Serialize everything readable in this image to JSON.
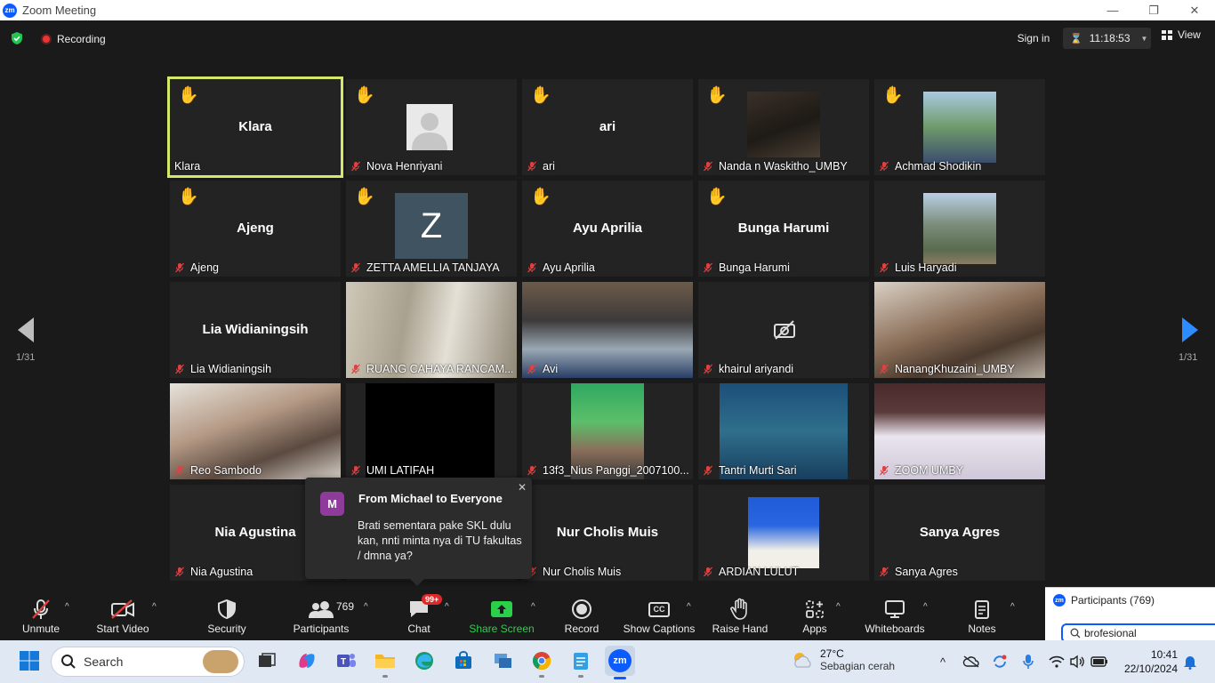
{
  "window": {
    "title": "Zoom Meeting",
    "logo": "zm"
  },
  "topbar": {
    "recording": "Recording",
    "sign_in": "Sign in",
    "timer": "11:18:53",
    "view": "View"
  },
  "gallery": {
    "page_left": "1/31",
    "page_right": "1/31",
    "tiles": [
      {
        "name": "Klara",
        "display": "Klara",
        "hand": true
      },
      {
        "name": "Nova Henriyani",
        "display": "",
        "hand": true
      },
      {
        "name": "ari",
        "display": "ari",
        "hand": true
      },
      {
        "name": "Nanda n Waskitho_UMBY",
        "display": "",
        "hand": true
      },
      {
        "name": "Achmad Shodikin",
        "display": "",
        "hand": true
      },
      {
        "name": "Ajeng",
        "display": "Ajeng",
        "hand": true
      },
      {
        "name": "ZETTA AMELLIA TANJAYA",
        "display": "",
        "hand": true,
        "avatar_letter": "Z"
      },
      {
        "name": "Ayu Aprilia",
        "display": "Ayu Aprilia",
        "hand": true
      },
      {
        "name": "Bunga Harumi",
        "display": "Bunga Harumi",
        "hand": true
      },
      {
        "name": "Luis Haryadi",
        "display": "",
        "hand": false
      },
      {
        "name": "Lia Widianingsih",
        "display": "Lia Widianingsih",
        "hand": false
      },
      {
        "name": "RUANG CAHAYA RANCAM...",
        "display": "",
        "hand": false
      },
      {
        "name": "Avi",
        "display": "",
        "hand": false
      },
      {
        "name": "khairul ariyandi",
        "display": "",
        "hand": false
      },
      {
        "name": "NanangKhuzaini_UMBY",
        "display": "",
        "hand": false
      },
      {
        "name": "Reo Sambodo",
        "display": "",
        "hand": false
      },
      {
        "name": "UMI LATIFAH",
        "display": "",
        "hand": false
      },
      {
        "name": "13f3_Nius Panggi_2007100...",
        "display": "",
        "hand": false
      },
      {
        "name": "Tantri Murti Sari",
        "display": "",
        "hand": false
      },
      {
        "name": "ZOOM UMBY",
        "display": "",
        "hand": false
      },
      {
        "name": "Nia Agustina",
        "display": "Nia Agustina",
        "hand": false
      },
      {
        "name": "",
        "display": "",
        "hand": false
      },
      {
        "name": "Nur Cholis Muis",
        "display": "Nur Cholis Muis",
        "hand": false
      },
      {
        "name": "ARDIAN LULUT",
        "display": "",
        "hand": false
      },
      {
        "name": "Sanya Agres",
        "display": "Sanya Agres",
        "hand": false
      }
    ]
  },
  "chat_toast": {
    "avatar": "M",
    "from": "From Michael to Everyone",
    "message": "Brati sementara pake SKL dulu kan, nnti minta nya di TU fakultas / dmna ya?"
  },
  "toolbar": {
    "unmute": "Unmute",
    "start_video": "Start Video",
    "security": "Security",
    "participants": "Participants",
    "participants_count": "769",
    "chat": "Chat",
    "chat_badge": "99+",
    "share_screen": "Share Screen",
    "record": "Record",
    "captions_icon": "CC",
    "show_captions": "Show Captions",
    "raise_hand": "Raise Hand",
    "apps": "Apps",
    "whiteboards": "Whiteboards",
    "notes": "Notes"
  },
  "participants_panel": {
    "title": "Participants (769)",
    "search_value": "brofesional"
  },
  "taskbar": {
    "search": "Search",
    "weather_temp": "27°C",
    "weather_desc": "Sebagian cerah",
    "time": "10:41",
    "date": "22/10/2024"
  },
  "colors": {
    "active_speaker_border": "#d6e86b",
    "share_green": "#2bd04a",
    "zoom_blue": "#0b5cff",
    "mute_red": "#e04040",
    "hand_yellow": "#f5c518"
  }
}
